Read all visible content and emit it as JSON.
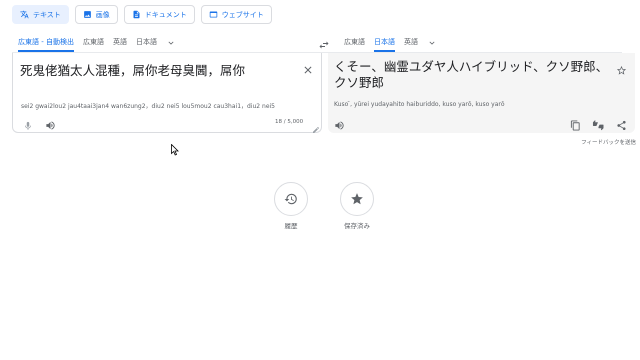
{
  "modes": [
    {
      "label": "テキスト",
      "icon": "translate-icon",
      "active": true
    },
    {
      "label": "画像",
      "icon": "image-icon",
      "active": false
    },
    {
      "label": "ドキュメント",
      "icon": "document-icon",
      "active": false
    },
    {
      "label": "ウェブサイト",
      "icon": "website-icon",
      "active": false
    }
  ],
  "source_langs": [
    "広東語 - 自動検出",
    "広東語",
    "英語",
    "日本語"
  ],
  "target_langs": [
    "広東語",
    "日本語",
    "英語"
  ],
  "source": {
    "text": "死鬼佬猶太人混種，屌你老母臭閪，屌你",
    "romanization": "sei2 gwai2lou2 jau4taai3jan4 wan6zung2，diu2 nei5 lou5mou2 cau3hai1，diu2 nei5",
    "char_count": "18 / 5,000"
  },
  "target": {
    "text": "くそー、幽霊ユダヤ人ハイブリッド、クソ野郎、クソ野郎",
    "romanization": "Kuso ̄, yūrei yudayahito haiburiddo, kuso yarō, kuso yarō"
  },
  "feedback_label": "フィードバックを送信",
  "history_label": "履歴",
  "saved_label": "保存済み",
  "colors": {
    "accent": "#1a73e8",
    "active_bg": "#e8f0fe",
    "panel_bg": "#f5f5f5"
  }
}
